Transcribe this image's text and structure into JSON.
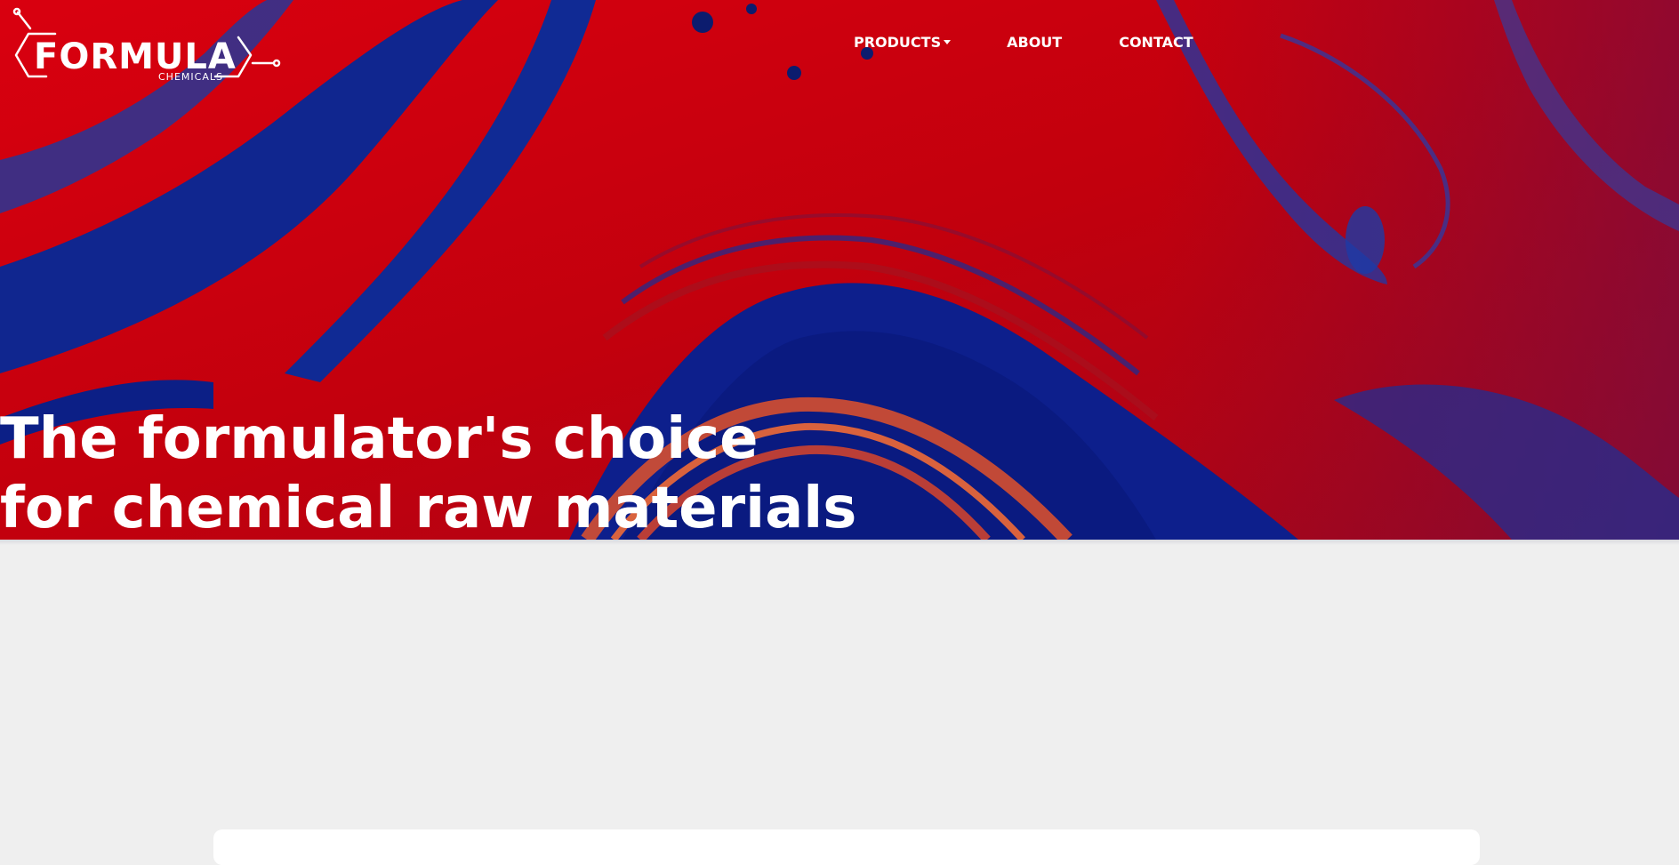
{
  "logo": {
    "word": "FORMULA",
    "sub": "CHEMICALS",
    "icon": "molecule-hexagon-icon"
  },
  "nav": {
    "products_label": "PRODUCTS",
    "about_label": "ABOUT",
    "contact_label": "CONTACT"
  },
  "hero": {
    "line1": "The formulator's choice",
    "line2": "for chemical raw materials"
  },
  "colors": {
    "hero_red": "#c4000f",
    "hero_blue": "#0d1f8c",
    "hero_orange": "#e2522a",
    "page_background": "#efefef"
  }
}
